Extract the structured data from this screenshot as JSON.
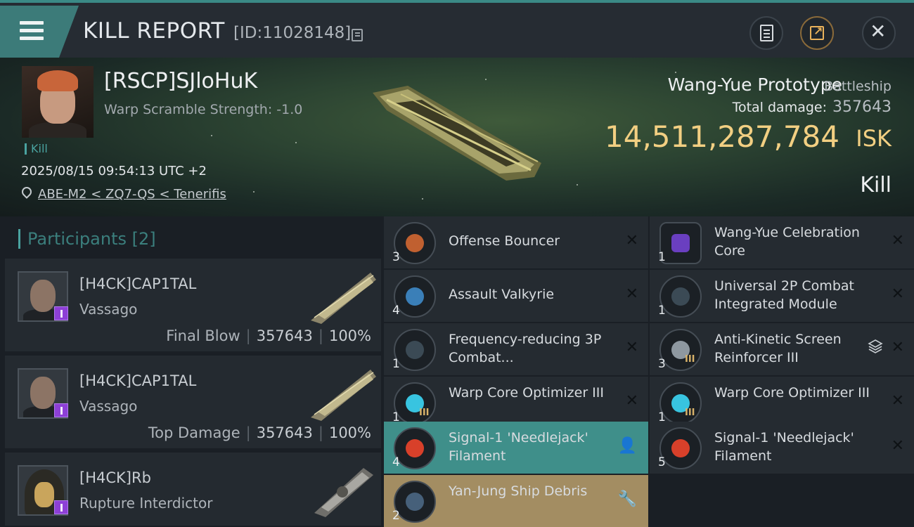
{
  "header": {
    "title": "KILL REPORT",
    "report_id": "[ID:11028148]"
  },
  "victim": {
    "name": "[RSCP]SJloHuK",
    "warp_scramble": "Warp Scramble Strength: -1.0",
    "tag": "Kill",
    "datetime": "2025/08/15 09:54:13 UTC +2",
    "location": "ABE-M2 < ZQ7-QS < Tenerifis",
    "ship_name": "Wang-Yue Prototype",
    "ship_class": "Battleship",
    "total_damage_label": "Total damage:",
    "total_damage": "357643",
    "isk_value": "14,511,287,784",
    "isk_unit": "ISK",
    "result": "Kill"
  },
  "participants": {
    "header": "Participants",
    "count": "[2]",
    "rows": [
      {
        "name": "[H4CK]CAP1TAL",
        "ship": "Vassago",
        "role": "Final Blow",
        "damage": "357643",
        "percent": "100%"
      },
      {
        "name": "[H4CK]CAP1TAL",
        "ship": "Vassago",
        "role": "Top Damage",
        "damage": "357643",
        "percent": "100%"
      },
      {
        "name": "[H4CK]Rb",
        "ship": "Rupture Interdictor",
        "role": "",
        "damage": "",
        "percent": ""
      }
    ]
  },
  "items": {
    "left": [
      {
        "qty": "3",
        "name": "Offense  Bouncer",
        "status": "destroyed",
        "icon": "bouncer-icon"
      },
      {
        "qty": "4",
        "name": "Assault Valkyrie",
        "status": "destroyed",
        "icon": "drone-icon"
      },
      {
        "qty": "1",
        "name": "Frequency-reducing 3P Combat...",
        "status": "destroyed",
        "icon": "module-icon"
      },
      {
        "qty": "1",
        "name": "Warp Core Optimizer III",
        "status": "destroyed",
        "meta": "III",
        "icon": "optimizer-icon"
      },
      {
        "qty": "4",
        "name": "Signal-1 'Needlejack' Filament",
        "status": "dropped",
        "icon": "filament-icon"
      },
      {
        "qty": "2",
        "name": "Yan-Jung Ship Debris",
        "status": "salvage",
        "icon": "debris-icon"
      }
    ],
    "right": [
      {
        "qty": "1",
        "name": "Wang-Yue Celebration Core",
        "status": "destroyed",
        "icon": "core-icon"
      },
      {
        "qty": "1",
        "name": "Universal 2P Combat Integrated Module",
        "status": "destroyed",
        "icon": "module-icon"
      },
      {
        "qty": "3",
        "name": "Anti-Kinetic Screen Reinforcer III",
        "status": "destroyed",
        "meta": "III",
        "stacked": true,
        "icon": "reinforcer-icon"
      },
      {
        "qty": "1",
        "name": "Warp Core Optimizer III",
        "status": "destroyed",
        "meta": "III",
        "icon": "optimizer-icon"
      },
      {
        "qty": "5",
        "name": "Signal-1 'Needlejack' Filament",
        "status": "destroyed",
        "icon": "filament-icon"
      }
    ]
  },
  "colors": {
    "accent_teal": "#4aa3a0",
    "isk_gold": "#f2cf82",
    "dropped_bg": "#3f8f8a",
    "salvage_bg": "#a38d62",
    "badge_purple": "#8d3fd6"
  }
}
